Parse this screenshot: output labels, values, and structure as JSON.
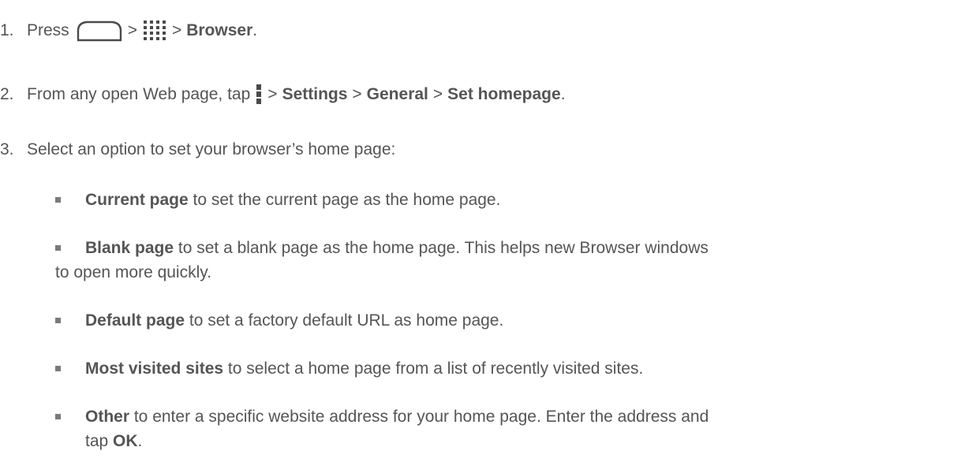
{
  "steps": [
    {
      "number": "1.",
      "press": "Press",
      "gt1": ">",
      "gt2": ">",
      "browser": "Browser",
      "period": "."
    },
    {
      "number": "2.",
      "lead": "From any open Web page, tap",
      "gt1": ">",
      "settings": "Settings",
      "gt2": ">",
      "general": "General",
      "gt3": ">",
      "set_homepage": "Set homepage",
      "period": "."
    },
    {
      "number": "3.",
      "text": "Select an option to set your browser’s home page:"
    }
  ],
  "options": [
    {
      "label": "Current page",
      "desc": " to set the current page as the home page."
    },
    {
      "label": "Blank page",
      "desc": " to set a blank page as the home page. This helps new Browser windows",
      "desc2": "to open more quickly."
    },
    {
      "label": "Default page",
      "desc": " to set a factory default URL as home page."
    },
    {
      "label": "Most visited sites",
      "desc": " to select a home page from a list of recently visited sites."
    },
    {
      "label": "Other",
      "desc": " to enter a specific website address for your home page. Enter the address and",
      "desc2_pre": "tap ",
      "desc2_bold": "OK",
      "desc2_post": "."
    }
  ],
  "icons": {
    "home": "home-icon",
    "apps": "apps-grid-icon",
    "menu": "menu-overflow-icon"
  }
}
